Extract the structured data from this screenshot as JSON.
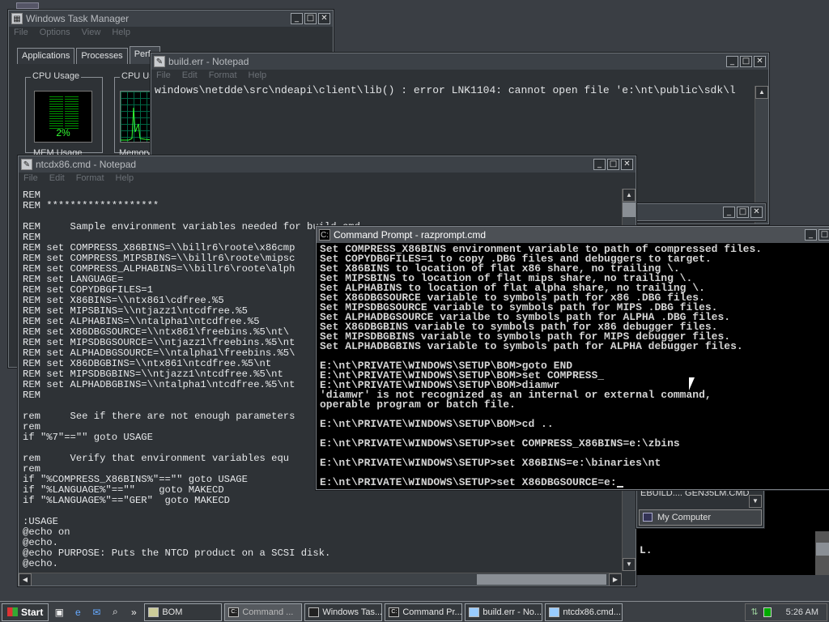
{
  "taskmgr": {
    "title": "Windows Task Manager",
    "menu": [
      "File",
      "Options",
      "View",
      "Help"
    ],
    "tabs": [
      "Applications",
      "Processes",
      "Perfo"
    ],
    "cpu_usage_label": "CPU Usage",
    "cpu_history_label": "CPU Us",
    "cpu_percent": "2%",
    "mem_usage_label": "MEM Usage",
    "memory_label": "Memory"
  },
  "builderr": {
    "title": "build.err - Notepad",
    "menu": [
      "File",
      "Edit",
      "Format",
      "Help"
    ],
    "line": "windows\\netdde\\src\\ndeapi\\client\\lib() : error LNK1104: cannot open file 'e:\\nt\\public\\sdk\\l"
  },
  "ntcdx": {
    "title": "ntcdx86.cmd - Notepad",
    "menu": [
      "File",
      "Edit",
      "Format",
      "Help"
    ],
    "lines": [
      "REM",
      "REM *******************",
      "",
      "REM     Sample environment variables needed for build.cmd",
      "REM",
      "REM set COMPRESS_X86BINS=\\\\billr6\\roote\\x86cmp",
      "REM set COMPRESS_MIPSBINS=\\\\billr6\\roote\\mipsc",
      "REM set COMPRESS_ALPHABINS=\\\\billr6\\roote\\alph",
      "REM set LANGUAGE=",
      "REM set COPYDBGFILES=1",
      "REM set X86BINS=\\\\ntx861\\cdfree.%5",
      "REM set MIPSBINS=\\\\ntjazz1\\ntcdfree.%5",
      "REM set ALPHABINS=\\\\ntalpha1\\ntcdfree.%5",
      "REM set X86DBGSOURCE=\\\\ntx861\\freebins.%5\\nt\\",
      "REM set MIPSDBGSOURCE=\\\\ntjazz1\\freebins.%5\\nt",
      "REM set ALPHADBGSOURCE=\\\\ntalpha1\\freebins.%5\\",
      "REM set X86DBGBINS=\\\\ntx861\\ntcdfree.%5\\nt",
      "REM set MIPSDBGBINS=\\\\ntjazz1\\ntcdfree.%5\\nt",
      "REM set ALPHADBGBINS=\\\\ntalpha1\\ntcdfree.%5\\nt",
      "REM",
      "",
      "rem     See if there are not enough parameters",
      "rem",
      "if \"%7\"==\"\" goto USAGE",
      "",
      "rem     Verify that environment variables equ",
      "rem",
      "if \"%COMPRESS_X86BINS%\"==\"\" goto USAGE",
      "if \"%LANGUAGE%\"==\"\"    goto MAKECD",
      "if \"%LANGUAGE%\"==\"GER\"  goto MAKECD",
      "",
      ":USAGE",
      "@echo on",
      "@echo.",
      "@echo PURPOSE: Puts the NTCD product on a SCSI disk.",
      "@echo."
    ]
  },
  "cmd": {
    "title": "Command Prompt - razprompt.cmd",
    "lines": [
      "Set COMPRESS_X86BINS environment variable to path of compressed files.",
      "Set COPYDBGFILES=1 to copy .DBG files and debuggers to target.",
      "Set X86BINS to location of flat x86 share, no trailing \\.",
      "Set MIPSBINS to location of flat mips share, no trailing \\.",
      "Set ALPHABINS to location of flat alpha share, no trailing \\.",
      "Set X86DBGSOURCE variable to symbols path for x86 .DBG files.",
      "Set MIPSDBGSOURCE variable to symbols path for MIPS .DBG files.",
      "Set ALPHADBGSOURCE varialbe to symbols path for ALPHA .DBG files.",
      "Set X86DBGBINS variable to symbols path for x86 debugger files.",
      "Set MIPSDBGBINS variable to symbols path for MIPS debugger files.",
      "Set ALPHADBGBINS variable to symbols path for ALPHA debugger files.",
      "",
      "E:\\nt\\PRIVATE\\WINDOWS\\SETUP\\BOM>goto END",
      "E:\\nt\\PRIVATE\\WINDOWS\\SETUP\\BOM>set COMPRESS_",
      "E:\\nt\\PRIVATE\\WINDOWS\\SETUP\\BOM>diamwr",
      "'diamwr' is not recognized as an internal or external command,",
      "operable program or batch file.",
      "",
      "E:\\nt\\PRIVATE\\WINDOWS\\SETUP\\BOM>cd ..",
      "",
      "E:\\nt\\PRIVATE\\WINDOWS\\SETUP>set COMPRESS_X86BINS=e:\\zbins",
      "",
      "E:\\nt\\PRIVATE\\WINDOWS\\SETUP>set X86BINS=e:\\binaries\\nt",
      ""
    ],
    "prompt": "E:\\nt\\PRIVATE\\WINDOWS\\SETUP>set X86DBGSOURCE=e:"
  },
  "explorer": {
    "files": "EBUILD....   GEN35LM.CMD",
    "address": "My Computer"
  },
  "console2": {
    "text": "L."
  },
  "taskbar": {
    "start": "Start",
    "items": [
      {
        "label": "BOM",
        "icon": "folder-icon"
      },
      {
        "label": "Command ...",
        "icon": "cmd-icon"
      },
      {
        "label": "Windows Tas...",
        "icon": "taskmgr-icon"
      },
      {
        "label": "Command Pr...",
        "icon": "cmd-icon"
      },
      {
        "label": "build.err - No...",
        "icon": "notepad-icon"
      },
      {
        "label": "ntcdx86.cmd...",
        "icon": "notepad-icon"
      }
    ],
    "clock": "5:26 AM"
  }
}
